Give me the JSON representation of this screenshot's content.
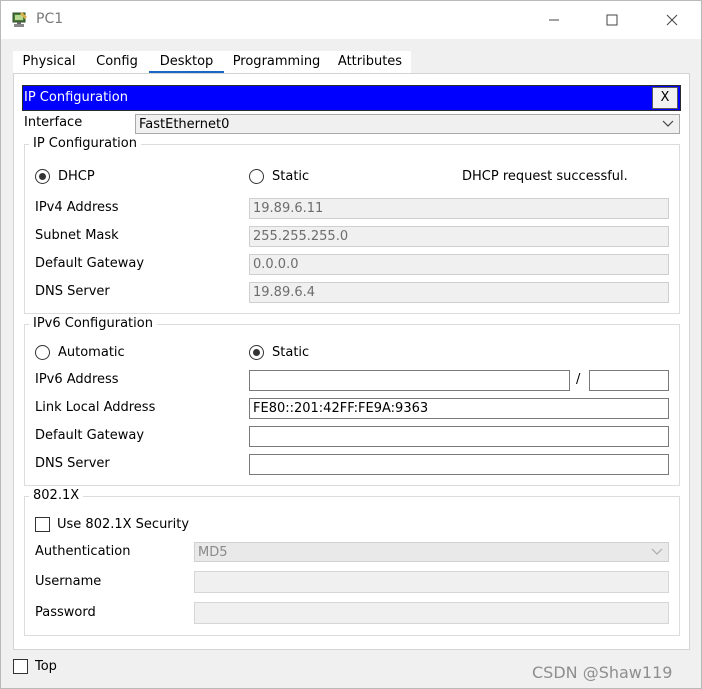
{
  "window": {
    "title": "PC1",
    "icon": "pc-icon",
    "controls": [
      "minimize-icon",
      "maximize-icon",
      "close-icon"
    ]
  },
  "tabs": [
    {
      "label": "Physical",
      "active": false
    },
    {
      "label": "Config",
      "active": false
    },
    {
      "label": "Desktop",
      "active": true
    },
    {
      "label": "Programming",
      "active": false
    },
    {
      "label": "Attributes",
      "active": false
    }
  ],
  "panel": {
    "title": "IP Configuration",
    "close_label": "X",
    "banner_color": "#0000ff"
  },
  "interface": {
    "label": "Interface",
    "value": "FastEthernet0"
  },
  "ipv4": {
    "legend": "IP Configuration",
    "dhcp_label": "DHCP",
    "static_label": "Static",
    "selected": "DHCP",
    "status": "DHCP request successful.",
    "fields": {
      "address": {
        "label": "IPv4 Address",
        "value": "19.89.6.11"
      },
      "mask": {
        "label": "Subnet Mask",
        "value": "255.255.255.0"
      },
      "gateway": {
        "label": "Default Gateway",
        "value": "0.0.0.0"
      },
      "dns": {
        "label": "DNS Server",
        "value": "19.89.6.4"
      }
    }
  },
  "ipv6": {
    "legend": "IPv6 Configuration",
    "automatic_label": "Automatic",
    "static_label": "Static",
    "selected": "Static",
    "slash": "/",
    "fields": {
      "address": {
        "label": "IPv6 Address",
        "value": "",
        "prefix": ""
      },
      "link_local": {
        "label": "Link Local Address",
        "value": "FE80::201:42FF:FE9A:9363"
      },
      "gateway": {
        "label": "Default Gateway",
        "value": ""
      },
      "dns": {
        "label": "DNS Server",
        "value": ""
      }
    }
  },
  "dot1x": {
    "legend": "802.1X",
    "use_security_label": "Use 802.1X Security",
    "use_security_checked": false,
    "authentication": {
      "label": "Authentication",
      "value": "MD5"
    },
    "username": {
      "label": "Username",
      "value": ""
    },
    "password": {
      "label": "Password",
      "value": ""
    }
  },
  "footer": {
    "top_label": "Top",
    "top_checked": false
  },
  "watermark": "CSDN @Shaw119"
}
